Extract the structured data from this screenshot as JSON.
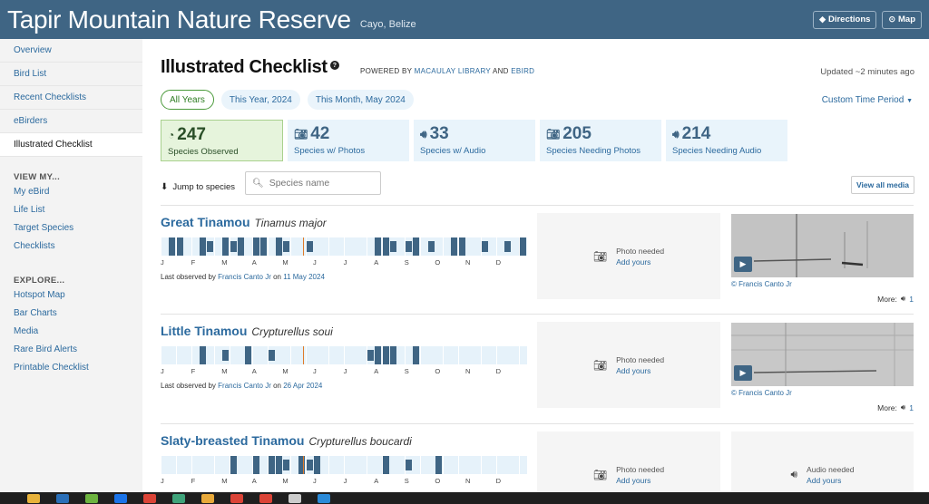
{
  "header": {
    "title": "Tapir Mountain Nature Reserve",
    "location": "Cayo,  Belize",
    "directions": "Directions",
    "map": "Map"
  },
  "sidebar": {
    "items": [
      "Overview",
      "Bird List",
      "Recent Checklists",
      "eBirders",
      "Illustrated Checklist"
    ],
    "view_my_head": "VIEW MY...",
    "view_my": [
      "My eBird",
      "Life List",
      "Target Species",
      "Checklists"
    ],
    "explore_head": "EXPLORE...",
    "explore": [
      "Hotspot Map",
      "Bar Charts",
      "Media",
      "Rare Bird Alerts",
      "Printable Checklist"
    ]
  },
  "main": {
    "title": "Illustrated Checklist",
    "powered_prefix": "POWERED BY",
    "macaulay": "MACAULAY LIBRARY",
    "and": "AND",
    "ebird": "EBIRD",
    "updated": "Updated ~2 minutes ago",
    "tabs": [
      "All Years",
      "This Year, 2024",
      "This Month, May 2024"
    ],
    "custom_period": "Custom Time Period",
    "stats": [
      {
        "num": "247",
        "label": "Species Observed"
      },
      {
        "num": "42",
        "label": "Species w/ Photos"
      },
      {
        "num": "33",
        "label": "Species w/ Audio"
      },
      {
        "num": "205",
        "label": "Species Needing Photos"
      },
      {
        "num": "214",
        "label": "Species Needing Audio"
      }
    ],
    "jump_label": "Jump to species",
    "search_placeholder": "Species name",
    "view_all": "View all media"
  },
  "months": [
    "J",
    "F",
    "M",
    "A",
    "M",
    "J",
    "J",
    "A",
    "S",
    "O",
    "N",
    "D"
  ],
  "colors": {
    "bar_high": "#3f6584",
    "bar_low": "#e6f2fa",
    "current_week": "#e07b2a"
  },
  "species": [
    {
      "common": "Great Tinamou",
      "scientific": "Tinamus major",
      "lastobs_prefix": "Last observed by",
      "observer": "Francis Canto Jr",
      "on": "on",
      "date": "11 May 2024",
      "photo_needed": "Photo needed",
      "add_yours": "Add yours",
      "credit": "© Francis Canto Jr",
      "more_label": "More:",
      "more_count": "1",
      "frequency": [
        0,
        2,
        2,
        0,
        0,
        2,
        1,
        0,
        2,
        1,
        2,
        0,
        2,
        2,
        0,
        2,
        1,
        0,
        0,
        1,
        0,
        0,
        0,
        0,
        0,
        0,
        0,
        0,
        2,
        2,
        1,
        0,
        1,
        2,
        0,
        1,
        0,
        0,
        2,
        2,
        0,
        0,
        1,
        0,
        0,
        1,
        0,
        2
      ]
    },
    {
      "common": "Little Tinamou",
      "scientific": "Crypturellus soui",
      "lastobs_prefix": "Last observed by",
      "observer": "Francis Canto Jr",
      "on": "on",
      "date": "26 Apr 2024",
      "photo_needed": "Photo needed",
      "add_yours": "Add yours",
      "credit": "© Francis Canto Jr",
      "more_label": "More:",
      "more_count": "1",
      "frequency": [
        0,
        0,
        0,
        0,
        0,
        2,
        0,
        0,
        1,
        0,
        0,
        2,
        0,
        0,
        1,
        0,
        0,
        0,
        0,
        0,
        0,
        0,
        0,
        0,
        0,
        0,
        0,
        1,
        2,
        2,
        2,
        0,
        0,
        2,
        0,
        0,
        0,
        0,
        0,
        0,
        0,
        0,
        0,
        0,
        0,
        0,
        0,
        0
      ]
    },
    {
      "common": "Slaty-breasted Tinamou",
      "scientific": "Crypturellus boucardi",
      "photo_needed": "Photo needed",
      "add_yours": "Add yours",
      "audio_needed": "Audio needed",
      "audio_add": "Add yours",
      "frequency": [
        0,
        0,
        0,
        0,
        0,
        0,
        0,
        0,
        0,
        2,
        0,
        0,
        2,
        0,
        2,
        2,
        1,
        0,
        2,
        1,
        2,
        0,
        0,
        0,
        0,
        0,
        0,
        0,
        0,
        2,
        0,
        0,
        1,
        0,
        0,
        0,
        2,
        0,
        0,
        0,
        0,
        0,
        0,
        0,
        0,
        0,
        0,
        0
      ]
    }
  ]
}
